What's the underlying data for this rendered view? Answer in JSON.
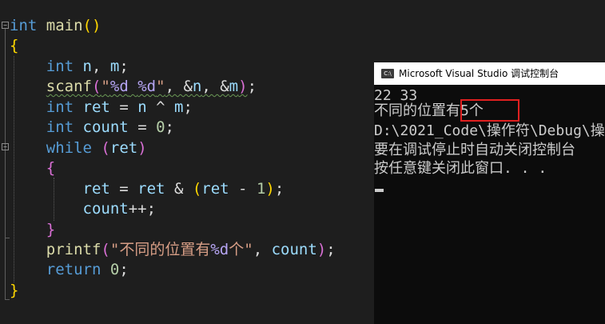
{
  "code": {
    "kw_int": "int",
    "fn_main": "main",
    "kw_while": "while",
    "kw_return": "return",
    "fn_scanf": "scanf",
    "fn_printf": "printf",
    "var_n": "n",
    "var_m": "m",
    "var_ret": "ret",
    "var_count": "count",
    "fmt_d": "%d",
    "str_printf_pre": "不同的位置有",
    "str_printf_post": "个",
    "num_zero": "0",
    "num_one": "1"
  },
  "console": {
    "title": "Microsoft Visual Studio 调试控制台",
    "icon_text": "C:\\",
    "lines": [
      "22 33",
      "不同的位置有5个",
      "D:\\2021_Code\\操作符\\Debug\\操",
      "要在调试停止时自动关闭控制台",
      "按任意键关闭此窗口. . ."
    ]
  },
  "colors": {
    "editor_bg": "#1e1e1e",
    "keyword": "#569cd6",
    "function": "#dcdcaa",
    "string": "#d69d85",
    "console_bg": "#0c0c0c",
    "highlight": "#e02020"
  }
}
